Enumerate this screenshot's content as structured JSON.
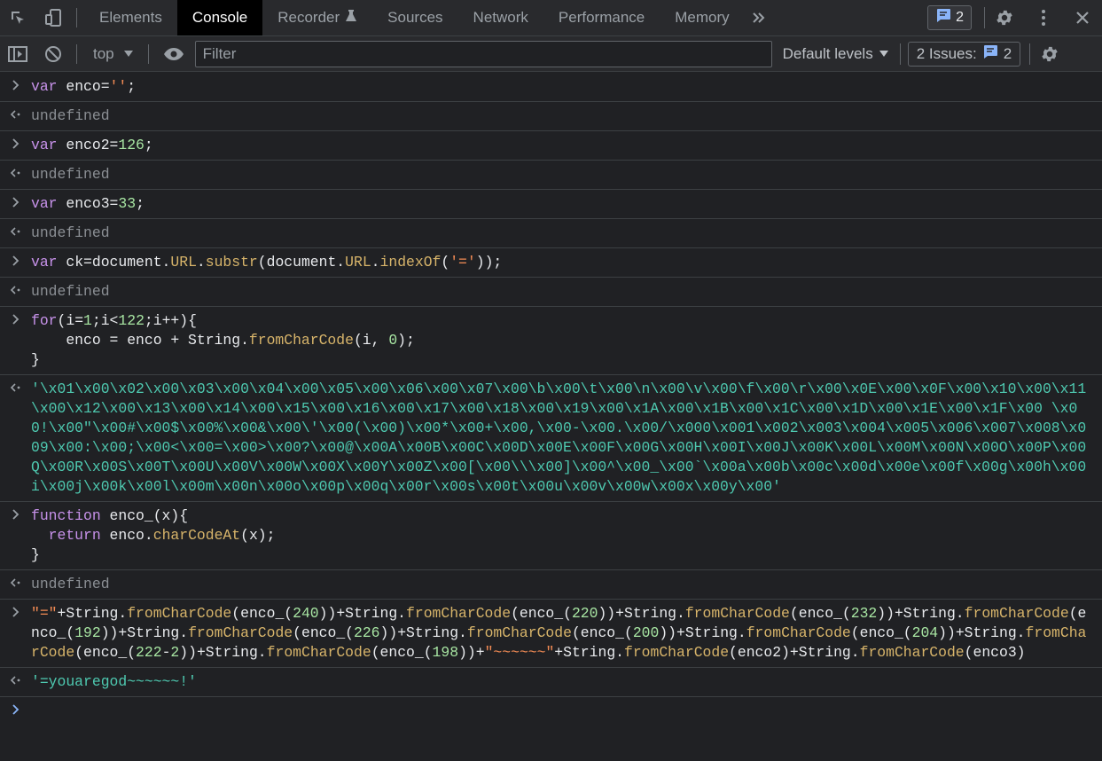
{
  "tabs": {
    "elements": "Elements",
    "console": "Console",
    "recorder": "Recorder",
    "sources": "Sources",
    "network": "Network",
    "performance": "Performance",
    "memory": "Memory"
  },
  "message_count": "2",
  "toolbar": {
    "context": "top",
    "filter_placeholder": "Filter",
    "levels": "Default levels",
    "issues_label": "2 Issues:",
    "issues_count": "2"
  },
  "console": {
    "undefined": "undefined",
    "e1_kw": "var",
    "e1_a": " enco=",
    "e1_str": "''",
    "e1_b": ";",
    "e2_kw": "var",
    "e2_a": " enco2=",
    "e2_num": "126",
    "e2_b": ";",
    "e3_kw": "var",
    "e3_a": " enco3=",
    "e3_num": "33",
    "e3_b": ";",
    "e4_kw": "var",
    "e4_a": " ck=document.",
    "e4_url1": "URL",
    "e4_b": ".",
    "e4_substr": "substr",
    "e4_c": "(document.",
    "e4_url2": "URL",
    "e4_d": ".",
    "e4_indexof": "indexOf",
    "e4_e": "(",
    "e4_str": "'='",
    "e4_f": "));",
    "e5_for": "for",
    "e5_a": "(i=",
    "e5_n1": "1",
    "e5_b": ";i<",
    "e5_n2": "122",
    "e5_c": ";i++){",
    "e5_d": "    enco = enco + String.",
    "e5_fcc": "fromCharCode",
    "e5_e": "(i, ",
    "e5_n3": "0",
    "e5_f": ");",
    "e5_g": "}",
    "e5_result": "'\\x01\\x00\\x02\\x00\\x03\\x00\\x04\\x00\\x05\\x00\\x06\\x00\\x07\\x00\\b\\x00\\t\\x00\\n\\x00\\v\\x00\\f\\x00\\r\\x00\\x0E\\x00\\x0F\\x00\\x10\\x00\\x11\\x00\\x12\\x00\\x13\\x00\\x14\\x00\\x15\\x00\\x16\\x00\\x17\\x00\\x18\\x00\\x19\\x00\\x1A\\x00\\x1B\\x00\\x1C\\x00\\x1D\\x00\\x1E\\x00\\x1F\\x00 \\x00!\\x00\"\\x00#\\x00$\\x00%\\x00&\\x00\\'\\x00(\\x00)\\x00*\\x00+\\x00,\\x00-\\x00.\\x00/\\x000\\x001\\x002\\x003\\x004\\x005\\x006\\x007\\x008\\x009\\x00:\\x00;\\x00<\\x00=\\x00>\\x00?\\x00@\\x00A\\x00B\\x00C\\x00D\\x00E\\x00F\\x00G\\x00H\\x00I\\x00J\\x00K\\x00L\\x00M\\x00N\\x00O\\x00P\\x00Q\\x00R\\x00S\\x00T\\x00U\\x00V\\x00W\\x00X\\x00Y\\x00Z\\x00[\\x00\\\\\\x00]\\x00^\\x00_\\x00`\\x00a\\x00b\\x00c\\x00d\\x00e\\x00f\\x00g\\x00h\\x00i\\x00j\\x00k\\x00l\\x00m\\x00n\\x00o\\x00p\\x00q\\x00r\\x00s\\x00t\\x00u\\x00v\\x00w\\x00x\\x00y\\x00'",
    "e6_function": "function",
    "e6_a": " enco_(x){",
    "e6_return": "  return",
    "e6_b": " enco.",
    "e6_cca": "charCodeAt",
    "e6_c": "(x);",
    "e6_d": "}",
    "e7_str1": "\"=\"",
    "e7_p1": "+String.",
    "e7_f1": "fromCharCode",
    "e7_a1": "(enco_(",
    "e7_n1": "240",
    "e7_b1": "))",
    "e7_p2": "+String.",
    "e7_f2": "fromCharCode",
    "e7_a2": "(enco_(",
    "e7_n2": "220",
    "e7_b2": "))",
    "e7_p3": "+String.",
    "e7_f3": "fromCharCode",
    "e7_a3": "(enco_(",
    "e7_n3": "232",
    "e7_b3": "))",
    "e7_p4": "+String.",
    "e7_f4": "fromCharCode",
    "e7_a4": "(enco_(",
    "e7_n4": "192",
    "e7_b4": "))",
    "e7_p5": "+String.",
    "e7_f5": "fromCharCode",
    "e7_a5": "(enco_(",
    "e7_n5": "226",
    "e7_b5": "))",
    "e7_p6": "+String.",
    "e7_f6": "fromCharCode",
    "e7_a6": "(enco_(",
    "e7_n6": "200",
    "e7_b6": "))",
    "e7_p7": "+String.",
    "e7_f7": "fromCharCode",
    "e7_a7": "(enco_(",
    "e7_n7": "204",
    "e7_b7": "))",
    "e7_p8": "+String.",
    "e7_f8": "fromCharCode",
    "e7_a8": "(enco_(",
    "e7_n8a": "222",
    "e7_m8": "-",
    "e7_n8b": "2",
    "e7_b8": "))",
    "e7_p9": "+String.",
    "e7_f9": "fromCharCode",
    "e7_a9": "(enco_(",
    "e7_n9": "198",
    "e7_b9": "))",
    "e7_plus": "+",
    "e7_tilde": "\"~~~~~~\"",
    "e7_p10": "+String.",
    "e7_f10": "fromCharCode",
    "e7_a10": "(enco2)",
    "e7_p11": "+String.",
    "e7_f11": "fromCharCode",
    "e7_a11": "(enco3)",
    "e7_result": "'=youaregod~~~~~~!'"
  },
  "colors": {
    "background": "#202124",
    "toolbar": "#292a2d",
    "accent_blue": "#8ab4f8",
    "string_result": "#4ec9b0",
    "keyword": "#c792ea",
    "method": "#d7b46a",
    "number": "#a8e6a3",
    "string": "#f28b54"
  }
}
